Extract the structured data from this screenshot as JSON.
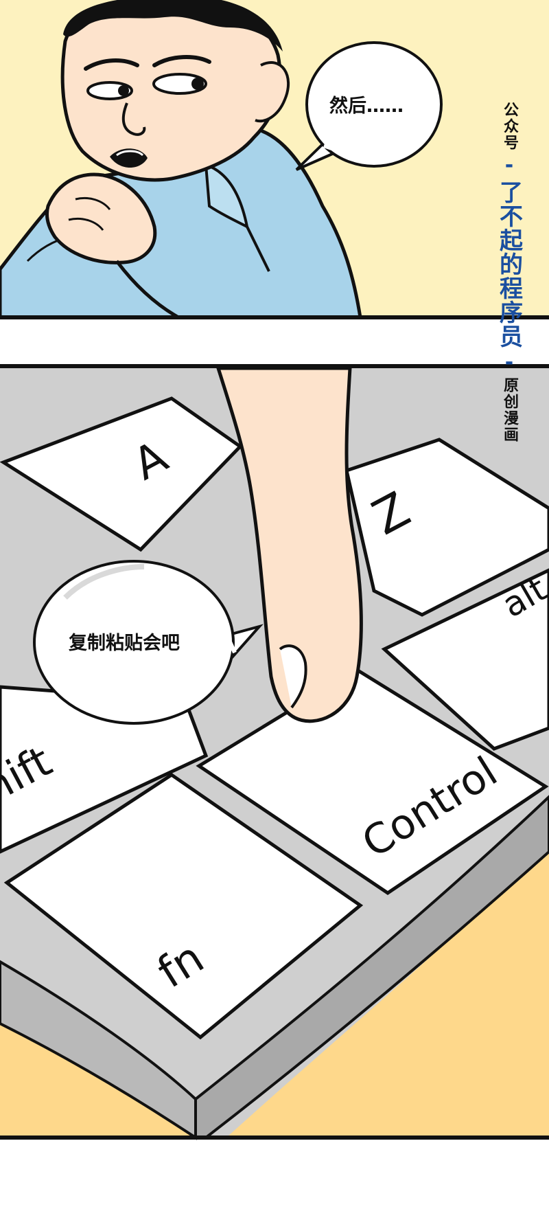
{
  "panel1": {
    "speech_bubble": {
      "text": "然后……"
    }
  },
  "watermark": {
    "prefix": "公众号",
    "separator": "-",
    "name": "了不起的程序员",
    "suffix": "原创漫画"
  },
  "panel2": {
    "speech_bubble": {
      "text": "复制粘贴会吧"
    },
    "keys": [
      {
        "label": "A"
      },
      {
        "label": "Z"
      },
      {
        "label": "alt"
      },
      {
        "label": "hift"
      },
      {
        "label": "Control"
      },
      {
        "label": "fn"
      }
    ]
  },
  "colors": {
    "panel1_background": "#fdf2bf",
    "shirt": "#a8d3ea",
    "skin": "#fde3cc",
    "keyboard_gray": "#cfcfcf",
    "table": "#fed88b",
    "brand_blue": "#1a4fa0"
  }
}
